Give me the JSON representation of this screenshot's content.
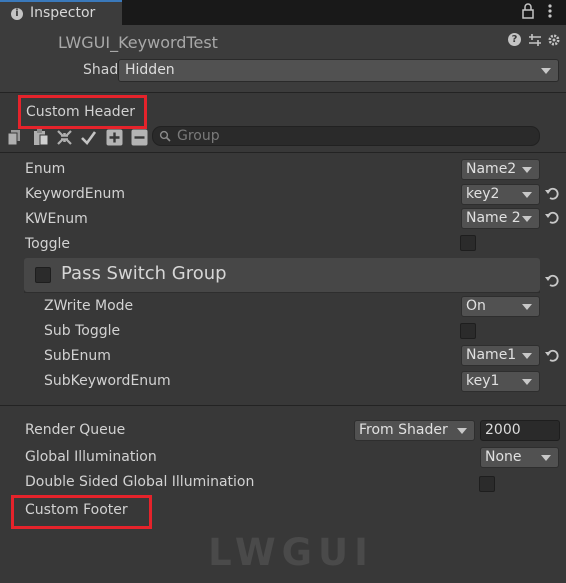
{
  "tab": {
    "title": "Inspector"
  },
  "header": {
    "material_name": "LWGUI_KeywordTest",
    "shader_label": "Shader",
    "shader_value": "Hidden"
  },
  "custom_header": "Custom Header",
  "search": {
    "placeholder": "Group"
  },
  "properties": {
    "enum": {
      "label": "Enum",
      "value": "Name2"
    },
    "keyword_enum": {
      "label": "KeywordEnum",
      "value": "key2"
    },
    "kw_enum": {
      "label": "KWEnum",
      "value": "Name 2"
    },
    "toggle": {
      "label": "Toggle"
    },
    "group": {
      "label": "Pass Switch Group"
    },
    "zwrite": {
      "label": "ZWrite Mode",
      "value": "On"
    },
    "sub_toggle": {
      "label": "Sub Toggle"
    },
    "sub_enum": {
      "label": "SubEnum",
      "value": "Name1"
    },
    "sub_keyword_enum": {
      "label": "SubKeywordEnum",
      "value": "key1"
    }
  },
  "footer_settings": {
    "render_queue": {
      "label": "Render Queue",
      "mode": "From Shader",
      "value": "2000"
    },
    "global_illumination": {
      "label": "Global Illumination",
      "value": "None"
    },
    "double_sided_gi": {
      "label": "Double Sided Global Illumination"
    }
  },
  "custom_footer": "Custom Footer",
  "logo": {
    "text": "LWGUI"
  },
  "colors": {
    "accent": "#3a79bb",
    "highlight": "#e5232b",
    "background": "#383838"
  },
  "icons": [
    "info-icon",
    "lock-icon",
    "more-icon",
    "help-icon",
    "preset-icon",
    "gear-icon",
    "copy-icon",
    "paste-icon",
    "collapse-icon",
    "check-icon",
    "plus-icon",
    "minus-icon",
    "search-icon",
    "revert-icon"
  ]
}
